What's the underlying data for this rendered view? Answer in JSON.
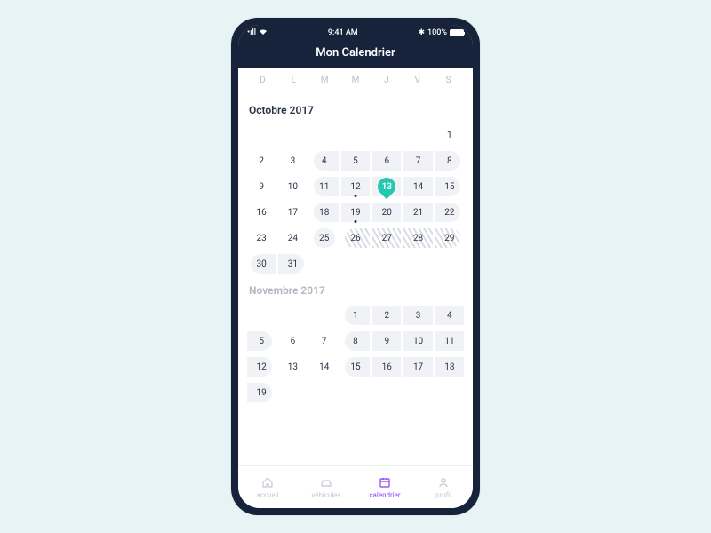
{
  "status": {
    "time": "9:41 AM",
    "battery": "100%",
    "bt": "✱",
    "signal": "•ıll",
    "wifi": "▾"
  },
  "title": "Mon Calendrier",
  "weekdays": [
    "D",
    "L",
    "M",
    "M",
    "J",
    "V",
    "S"
  ],
  "months": [
    {
      "label": "Octobre 2017",
      "muted": false,
      "offset": 0,
      "days": [
        {
          "n": ""
        },
        {
          "n": ""
        },
        {
          "n": ""
        },
        {
          "n": ""
        },
        {
          "n": ""
        },
        {
          "n": ""
        },
        {
          "n": 1
        },
        {
          "n": 2
        },
        {
          "n": 3
        },
        {
          "n": 4,
          "p": "start"
        },
        {
          "n": 5,
          "p": "mid"
        },
        {
          "n": 6,
          "p": "mid"
        },
        {
          "n": 7,
          "p": "mid"
        },
        {
          "n": 8,
          "p": "end"
        },
        {
          "n": 9
        },
        {
          "n": 10
        },
        {
          "n": 11,
          "p": "start"
        },
        {
          "n": 12,
          "p": "mid",
          "dot": true
        },
        {
          "n": 13,
          "p": "mid",
          "today": true
        },
        {
          "n": 14,
          "p": "mid"
        },
        {
          "n": 15,
          "p": "end"
        },
        {
          "n": 16
        },
        {
          "n": 17
        },
        {
          "n": 18,
          "p": "start"
        },
        {
          "n": 19,
          "p": "mid",
          "dot": true
        },
        {
          "n": 20,
          "p": "mid"
        },
        {
          "n": 21,
          "p": "mid"
        },
        {
          "n": 22,
          "p": "end"
        },
        {
          "n": 23
        },
        {
          "n": 24
        },
        {
          "n": 25,
          "p": "single"
        },
        {
          "n": 26,
          "p": "start",
          "h": true
        },
        {
          "n": 27,
          "p": "mid",
          "h": true
        },
        {
          "n": 28,
          "p": "mid",
          "h": true
        },
        {
          "n": 29,
          "p": "end",
          "h": true
        },
        {
          "n": 30,
          "p": "start"
        },
        {
          "n": 31,
          "p": "end"
        }
      ]
    },
    {
      "label": "Novembre 2017",
      "muted": true,
      "offset": 0,
      "days": [
        {
          "n": ""
        },
        {
          "n": ""
        },
        {
          "n": ""
        },
        {
          "n": 1,
          "p": "start"
        },
        {
          "n": 2,
          "p": "mid"
        },
        {
          "n": 3,
          "p": "mid"
        },
        {
          "n": 4,
          "p": "mid"
        },
        {
          "n": 5,
          "p": "end"
        },
        {
          "n": 6
        },
        {
          "n": 7
        },
        {
          "n": 8,
          "p": "start"
        },
        {
          "n": 9,
          "p": "mid"
        },
        {
          "n": 10,
          "p": "mid"
        },
        {
          "n": 11,
          "p": "mid"
        },
        {
          "n": 12,
          "p": "end"
        },
        {
          "n": 13
        },
        {
          "n": 14
        },
        {
          "n": 15,
          "p": "start"
        },
        {
          "n": 16,
          "p": "mid"
        },
        {
          "n": 17,
          "p": "mid"
        },
        {
          "n": 18,
          "p": "mid"
        },
        {
          "n": 19,
          "p": "end"
        }
      ]
    }
  ],
  "tabs": [
    {
      "id": "accueil",
      "label": "accueil",
      "icon": "home"
    },
    {
      "id": "vehicules",
      "label": "véhicules",
      "icon": "car"
    },
    {
      "id": "calendrier",
      "label": "calendrier",
      "icon": "calendar",
      "active": true
    },
    {
      "id": "profil",
      "label": "profil",
      "icon": "profile"
    }
  ]
}
